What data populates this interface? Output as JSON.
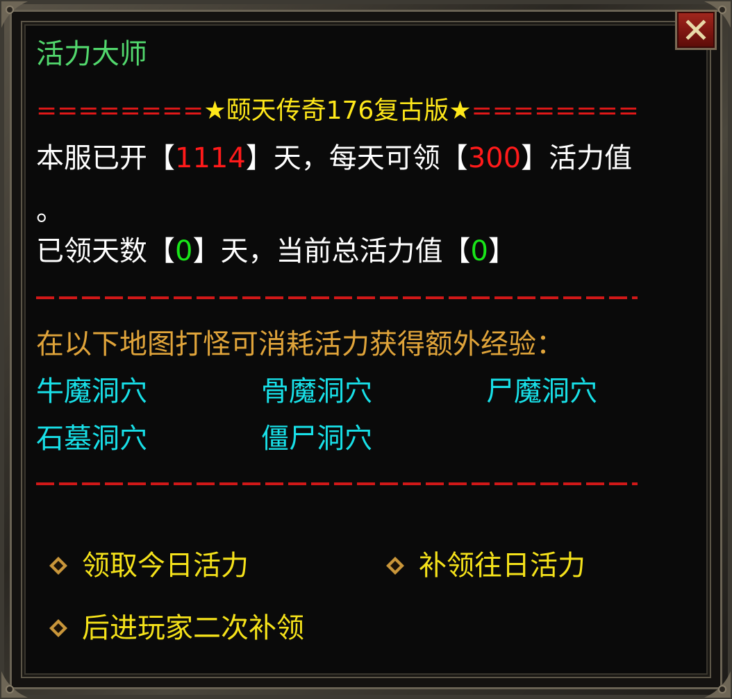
{
  "panel": {
    "title": "活力大师",
    "close_icon": "close-x-icon"
  },
  "banner": {
    "left_separator": "========",
    "star_left": "★",
    "title": "颐天传奇176复古版",
    "star_right": "★",
    "right_separator": "========"
  },
  "info": {
    "open_prefix": "本服已开【",
    "open_days": "1114",
    "open_mid": "】天，每天可领【",
    "daily_points": "300",
    "open_suffix": "】活力值",
    "open_period": "。",
    "claimed_prefix": "已领天数【",
    "claimed_days": "0",
    "claimed_mid": "】天，当前总活力值【",
    "total_points": "0",
    "claimed_suffix": "】"
  },
  "maps": {
    "intro": "在以下地图打怪可消耗活力获得额外经验：",
    "items": [
      "牛魔洞穴",
      "骨魔洞穴",
      "尸魔洞穴",
      "石墓洞穴",
      "僵尸洞穴"
    ]
  },
  "actions": {
    "claim_today": "领取今日活力",
    "claim_past": "补领往日活力",
    "newcomer": "后进玩家二次补领",
    "bullet_icon": "diamond-bullet-icon"
  },
  "colors": {
    "title_green": "#52d86d",
    "highlight_red": "#ff1a1a",
    "highlight_green": "#19e619",
    "intro_orange": "#e0a43a",
    "map_cyan": "#18e0e8",
    "action_yellow": "#f5e21a",
    "banner_yellow": "#ffe81a"
  }
}
